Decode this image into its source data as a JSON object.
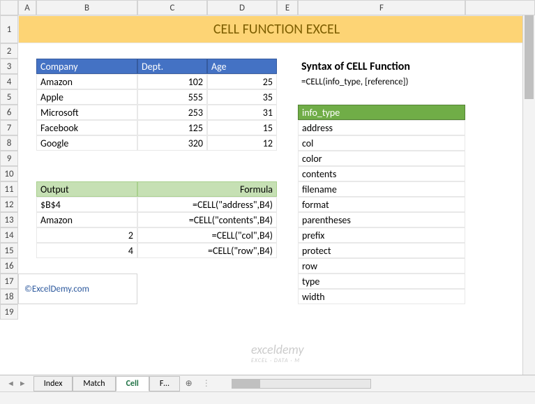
{
  "cols": [
    "",
    "A",
    "B",
    "C",
    "D",
    "E",
    "F",
    ""
  ],
  "rows": [
    "1",
    "2",
    "3",
    "4",
    "5",
    "6",
    "7",
    "8",
    "9",
    "10",
    "11",
    "12",
    "13",
    "14",
    "15",
    "16",
    "17",
    "18",
    "19"
  ],
  "title": "CELL FUNCTION EXCEL",
  "table1": {
    "h": [
      "Company",
      "Dept.",
      "Age"
    ],
    "rows": [
      [
        "Amazon",
        "102",
        "25"
      ],
      [
        "Apple",
        "555",
        "35"
      ],
      [
        "Microsoft",
        "253",
        "31"
      ],
      [
        "Facebook",
        "125",
        "15"
      ],
      [
        "Google",
        "320",
        "12"
      ]
    ]
  },
  "table2": {
    "h": [
      "Output",
      "Formula"
    ],
    "rows": [
      [
        "$B$4",
        "=CELL(\"address\",B4)"
      ],
      [
        "Amazon",
        "=CELL(\"contents\",B4)"
      ],
      [
        "2",
        "=CELL(\"col\",B4)"
      ],
      [
        "4",
        "=CELL(\"row\",B4)"
      ]
    ]
  },
  "syntax": {
    "title": "Syntax of CELL Function",
    "formula": "=CELL(info_type, [reference])"
  },
  "info_type": {
    "h": "info_type",
    "rows": [
      "address",
      "col",
      "color",
      "contents",
      "filename",
      "format",
      "parentheses",
      "prefix",
      "protect",
      "row",
      "type",
      "width"
    ]
  },
  "credit": "©ExcelDemy.com",
  "sheets": [
    "Index",
    "Match",
    "Cell",
    "F…"
  ],
  "active_sheet": 2,
  "watermark": {
    "main": "exceldemy",
    "sub": "EXCEL · DATA · M"
  }
}
